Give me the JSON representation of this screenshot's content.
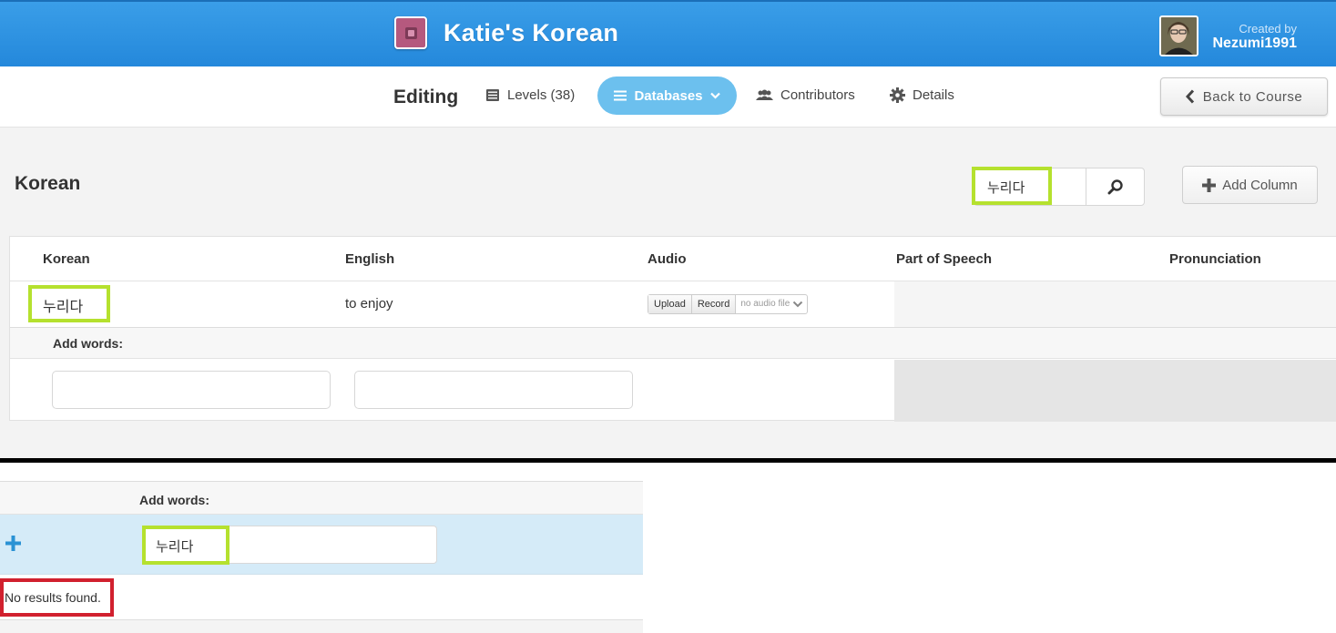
{
  "header": {
    "course_title": "Katie's Korean",
    "creator_label": "Created by",
    "creator_name": "Nezumi1991",
    "colors": {
      "bar": "#2a8fde",
      "logo": "#b5597e"
    }
  },
  "subnav": {
    "editing_label": "Editing",
    "levels_label": "Levels (38)",
    "databases_label": "Databases",
    "contributors_label": "Contributors",
    "details_label": "Details",
    "back_label": "Back to Course",
    "active_color": "#6cc0ee"
  },
  "database": {
    "title": "Korean",
    "search_value": "누리다",
    "add_column_label": "Add Column",
    "columns": [
      "Korean",
      "English",
      "Audio",
      "Part of Speech",
      "Pronunciation"
    ],
    "row": {
      "korean": "누리다",
      "english": "to enjoy",
      "audio_upload": "Upload",
      "audio_record": "Record",
      "audio_status": "no audio file"
    },
    "add_words_label": "Add words:"
  },
  "bottom": {
    "add_words_label": "Add words:",
    "input_value": "누리다",
    "no_results": "No results found."
  },
  "highlight_colors": {
    "green": "#b5e12e",
    "red": "#d1202e"
  }
}
